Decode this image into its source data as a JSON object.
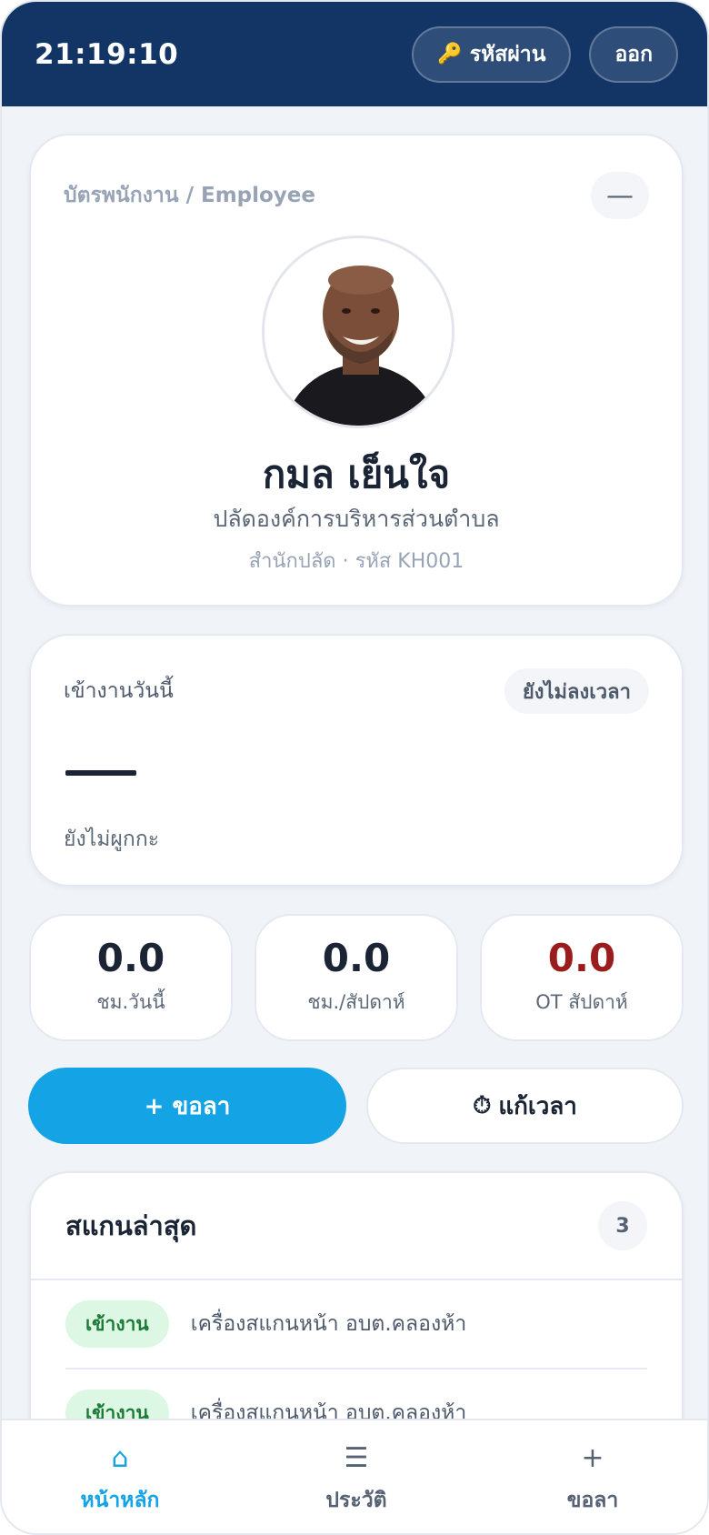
{
  "header": {
    "clock": "21:19:10",
    "password_label": "รหัสผ่าน",
    "logout_label": "ออก"
  },
  "employee_card": {
    "section_label": "บัตรพนักงาน / Employee",
    "collapse_symbol": "—",
    "name": "กมล เย็นใจ",
    "position": "ปลัดองค์การบริหารส่วนตำบล",
    "department_code": "สำนักปลัด · รหัส KH001"
  },
  "attendance": {
    "title": "เข้างานวันนี้",
    "status": "ยังไม่ลงเวลา",
    "shift_note": "ยังไม่ผูกกะ"
  },
  "stats": [
    {
      "value": "0.0",
      "label": "ชม.วันนี้"
    },
    {
      "value": "0.0",
      "label": "ชม./สัปดาห์"
    },
    {
      "value": "0.0",
      "label": "OT สัปดาห์"
    }
  ],
  "actions": {
    "leave_label": "+ ขอลา",
    "fix_time_label": "แก้เวลา"
  },
  "recent_scans": {
    "title": "สแกนล่าสุด",
    "count": "3",
    "items": [
      {
        "type": "เข้างาน",
        "device": "เครื่องสแกนหน้า อบต.คลองห้า"
      },
      {
        "type": "เข้างาน",
        "device": "เครื่องสแกนหน้า อบต.คลองห้า"
      }
    ]
  },
  "nav": [
    {
      "label": "หน้าหลัก",
      "icon": "home-icon",
      "glyph": "⌂"
    },
    {
      "label": "ประวัติ",
      "icon": "list-icon",
      "glyph": "☰"
    },
    {
      "label": "ขอลา",
      "icon": "plus-icon",
      "glyph": "+"
    }
  ],
  "colors": {
    "header_bg": "#123566",
    "accent": "#14a3e4",
    "ot_value": "#9b1c1c",
    "checkin_chip_bg": "#dcf7e3",
    "checkin_chip_text": "#1d7a36"
  }
}
